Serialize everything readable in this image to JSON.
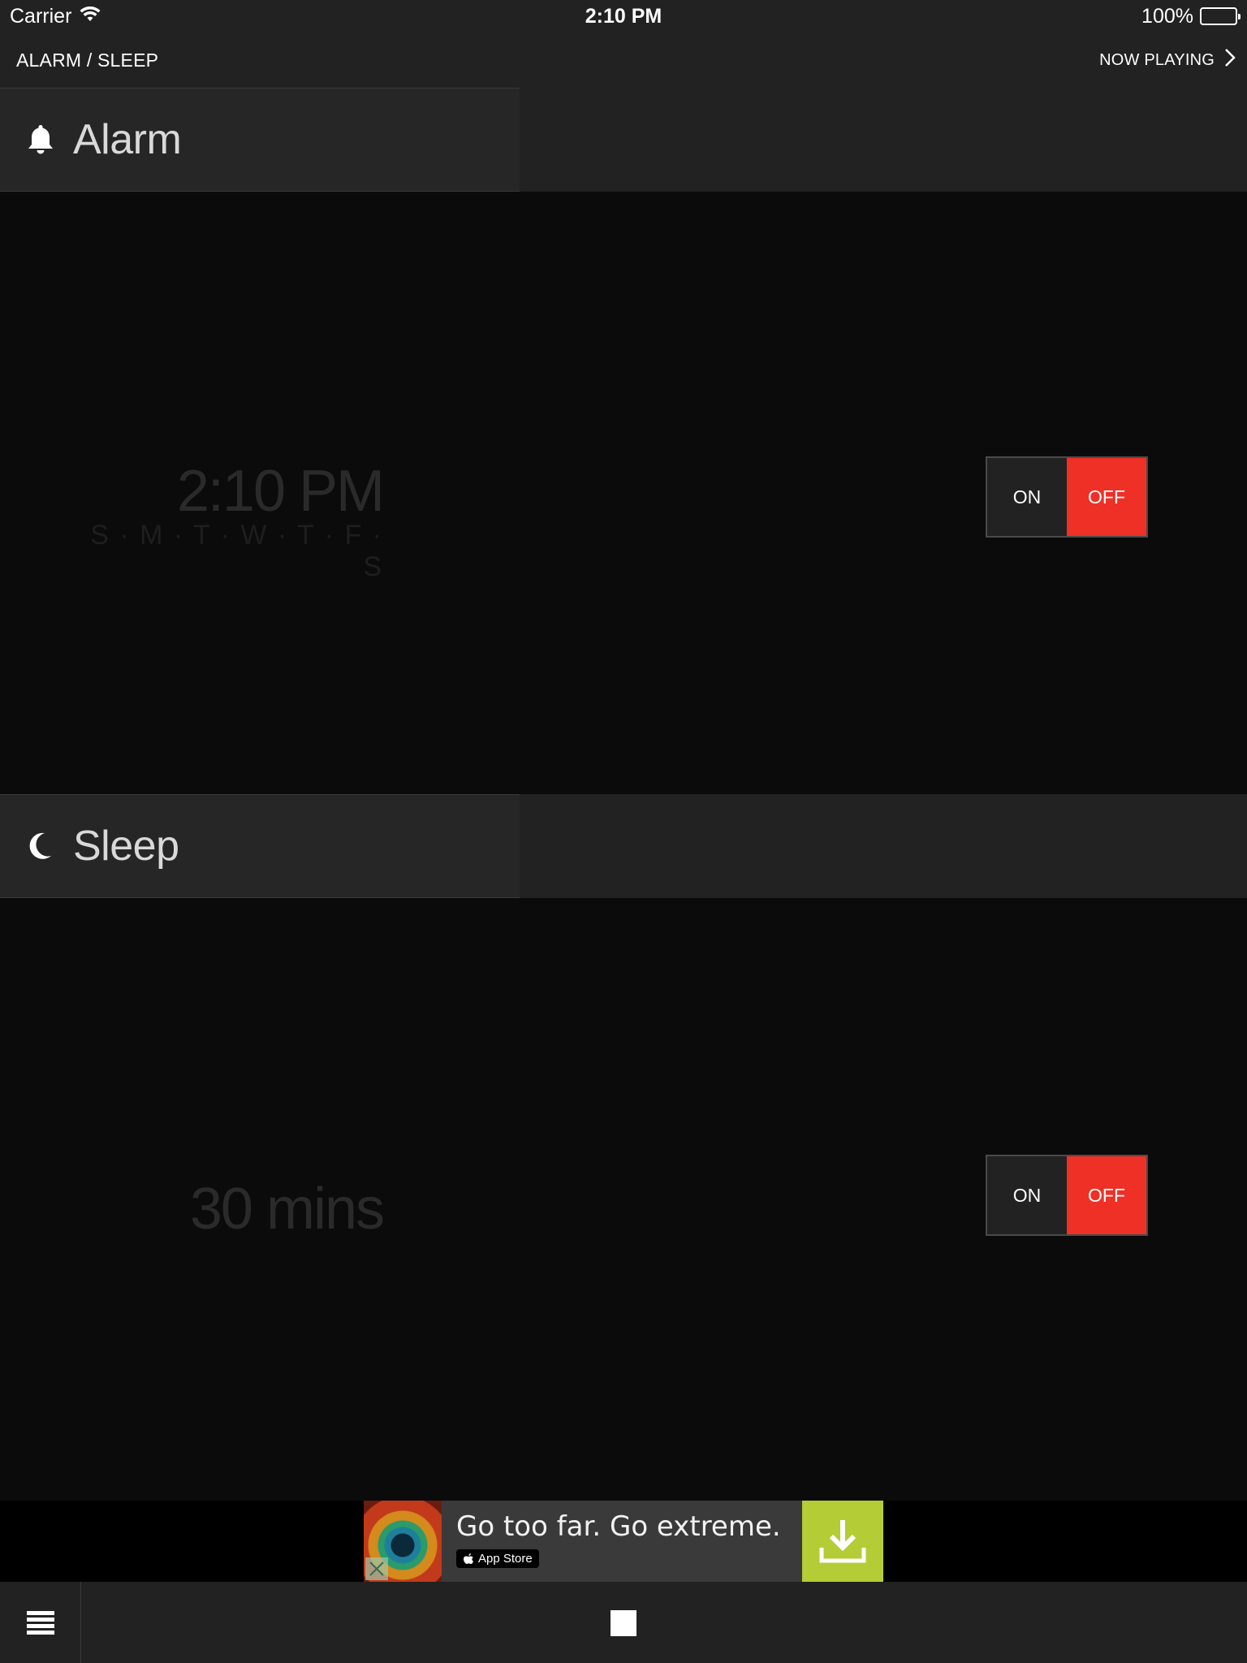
{
  "status_bar": {
    "carrier": "Carrier",
    "time": "2:10 PM",
    "battery": "100%"
  },
  "nav": {
    "title": "ALARM / SLEEP",
    "now_playing": "NOW PLAYING"
  },
  "alarm": {
    "title": "Alarm",
    "time": "2:10 PM",
    "days": "S · M · T · W · T · F · S",
    "toggle_on": "ON",
    "toggle_off": "OFF"
  },
  "sleep": {
    "title": "Sleep",
    "duration": "30 mins",
    "toggle_on": "ON",
    "toggle_off": "OFF"
  },
  "ad": {
    "headline": "Go too far. Go extreme.",
    "badge": "App Store"
  },
  "colors": {
    "accent_off": "#ee3027",
    "ad_download": "#b4cc35"
  }
}
